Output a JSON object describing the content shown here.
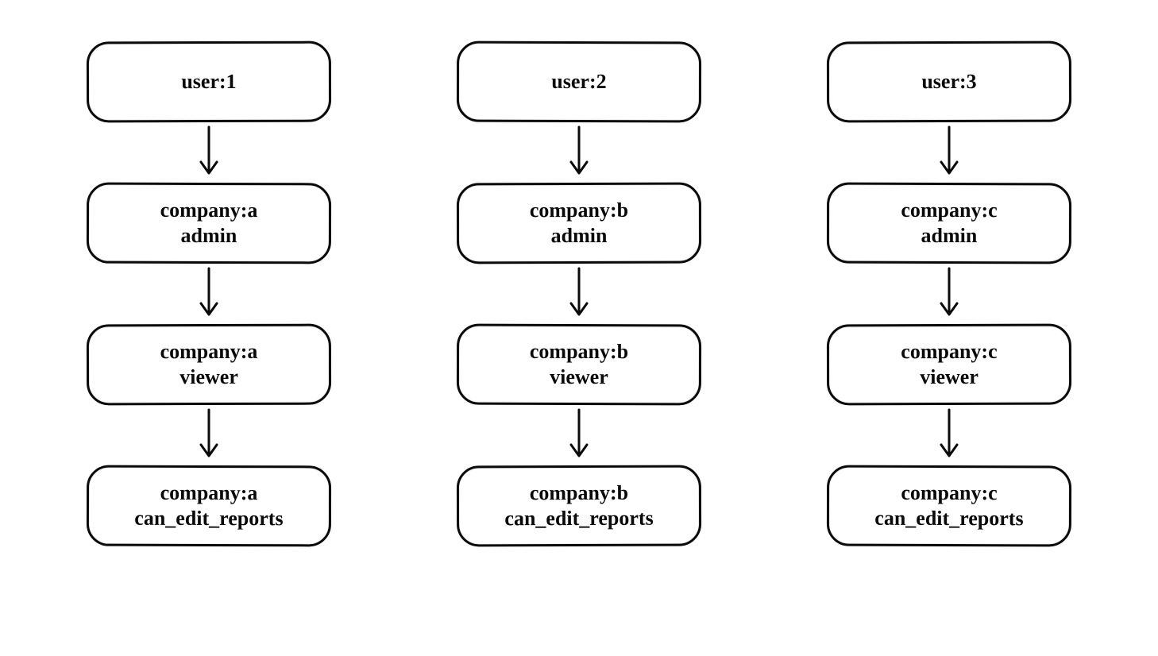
{
  "columns": [
    {
      "nodes": [
        {
          "line1": "user:1",
          "line2": ""
        },
        {
          "line1": "company:a",
          "line2": "admin"
        },
        {
          "line1": "company:a",
          "line2": "viewer"
        },
        {
          "line1": "company:a",
          "line2": "can_edit_reports"
        }
      ]
    },
    {
      "nodes": [
        {
          "line1": "user:2",
          "line2": ""
        },
        {
          "line1": "company:b",
          "line2": "admin"
        },
        {
          "line1": "company:b",
          "line2": "viewer"
        },
        {
          "line1": "company:b",
          "line2": "can_edit_reports"
        }
      ]
    },
    {
      "nodes": [
        {
          "line1": "user:3",
          "line2": ""
        },
        {
          "line1": "company:c",
          "line2": "admin"
        },
        {
          "line1": "company:c",
          "line2": "viewer"
        },
        {
          "line1": "company:c",
          "line2": "can_edit_reports"
        }
      ]
    }
  ]
}
